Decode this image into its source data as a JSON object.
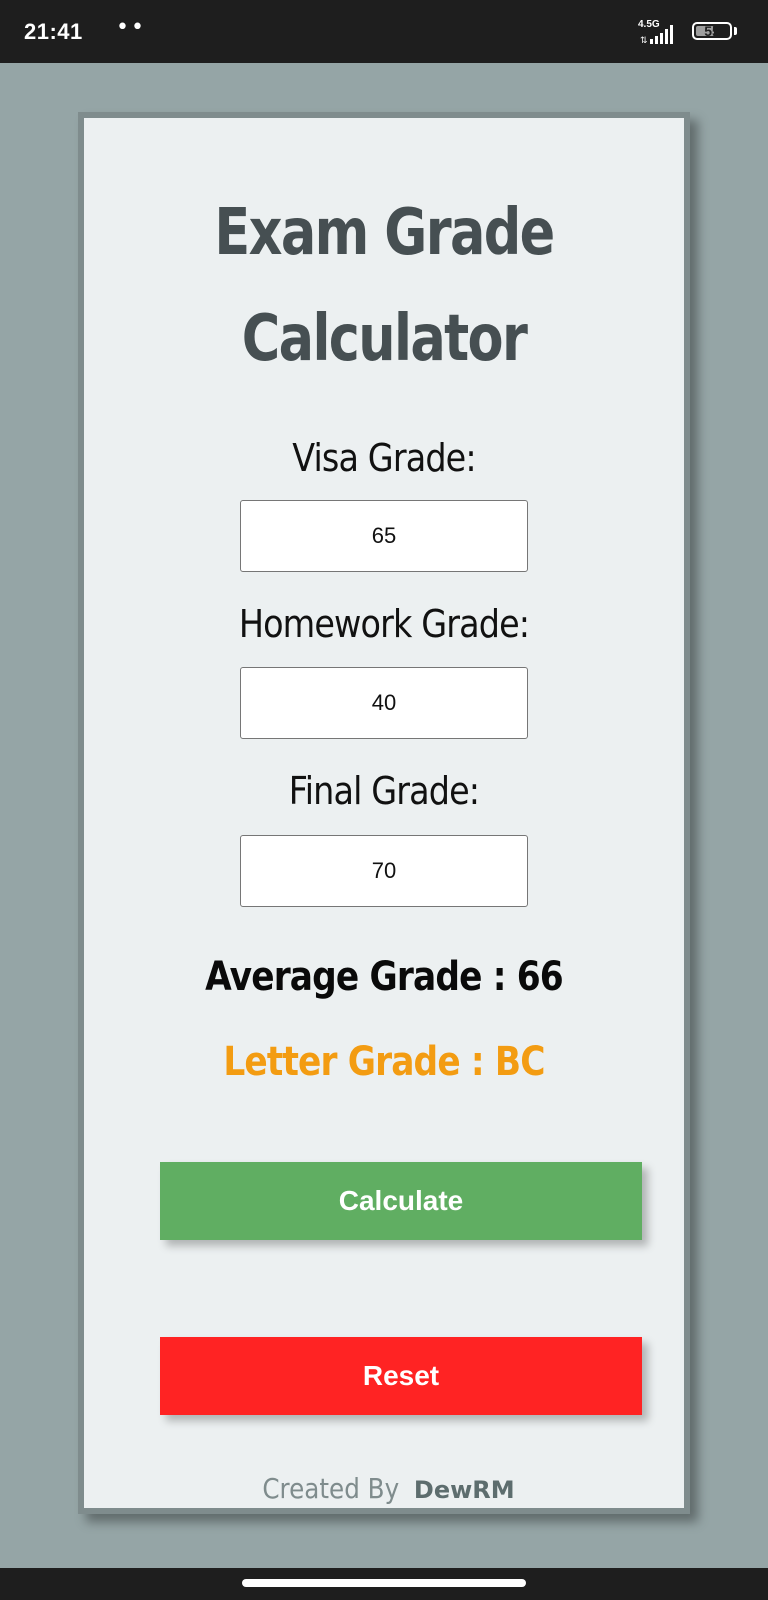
{
  "status_bar": {
    "time": "21:41",
    "notification_dots": "••",
    "network_type": "4.5G",
    "battery_level": "55",
    "battery_fraction": 0.55
  },
  "app": {
    "title_line1": "Exam Grade",
    "title_line2": "Calculator",
    "fields": [
      {
        "label": "Visa Grade:",
        "value": "65"
      },
      {
        "label": "Homework Grade:",
        "value": "40"
      },
      {
        "label": "Final Grade:",
        "value": "70"
      }
    ],
    "average_text": "Average Grade : 66",
    "letter_text": "Letter Grade : BC",
    "calculate_label": "Calculate",
    "reset_label": "Reset",
    "footer_prefix": "Created By",
    "footer_author": "DewRM"
  },
  "colors": {
    "background": "#95a5a6",
    "card": "#ecf0f1",
    "letter_grade": "#f39c12",
    "calculate_button": "#60ae62",
    "reset_button": "#ff2323"
  }
}
